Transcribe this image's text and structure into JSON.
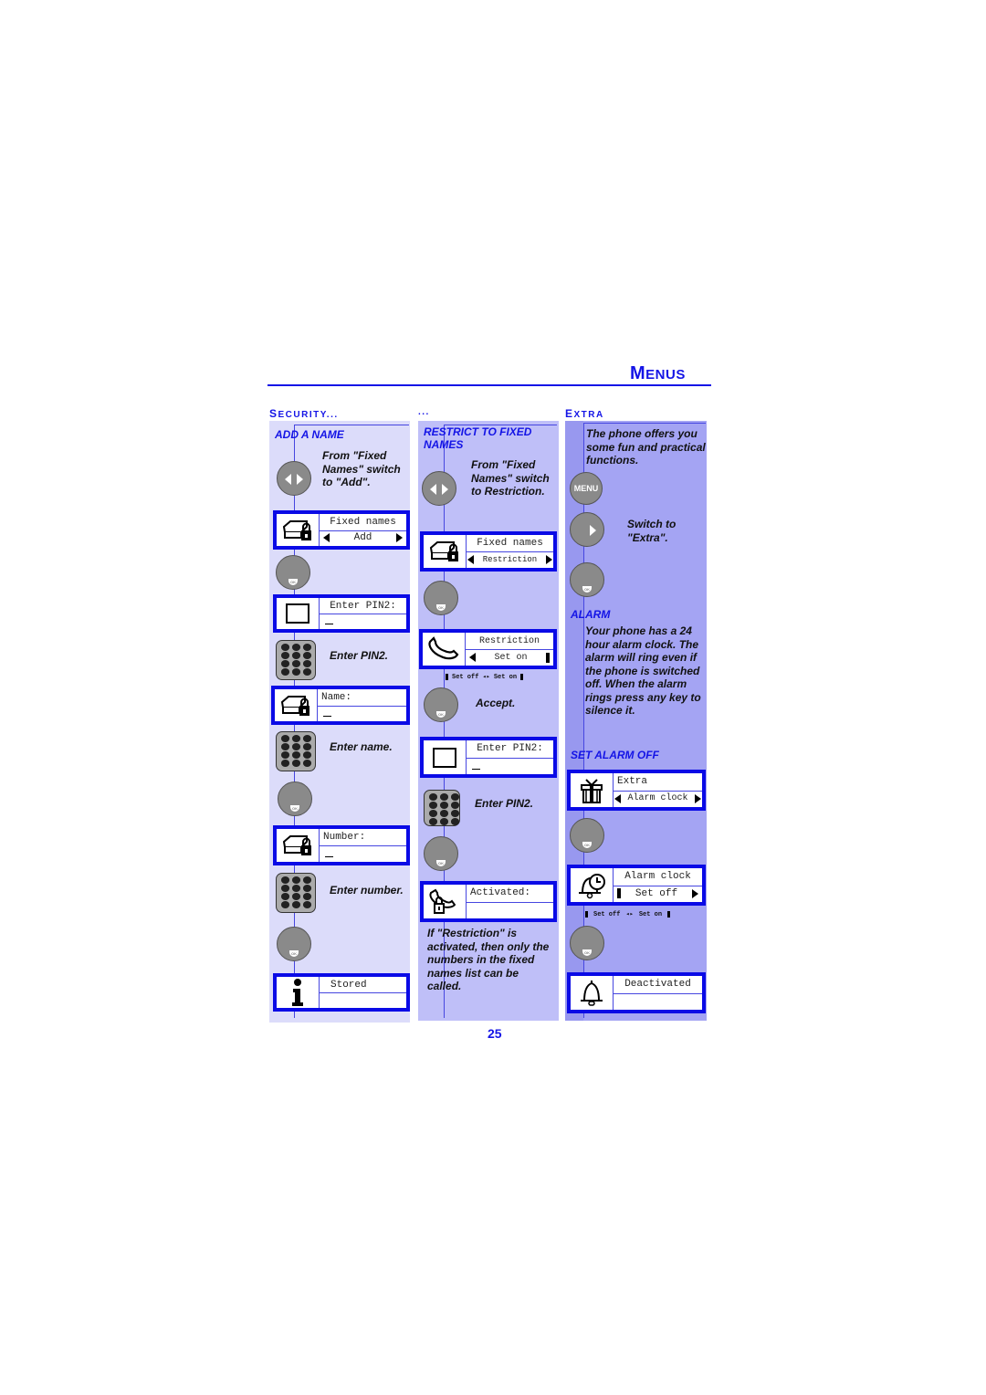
{
  "header": {
    "title_first": "M",
    "title_rest": "ENUS"
  },
  "sections": {
    "security": {
      "cap": "S",
      "rest": "ECURITY..."
    },
    "continued": {
      "label": "..."
    },
    "extra": {
      "cap": "E",
      "rest": "XTRA"
    }
  },
  "col1": {
    "title": "ADD A NAME",
    "step1_note": "From \"Fixed Names\" switch to \"Add\".",
    "screen1": {
      "line1": "Fixed names",
      "line2": "Add",
      "icon": "phonebook-lock-icon"
    },
    "screen2": {
      "line1": "Enter PIN2:",
      "icon": "empty-square-icon"
    },
    "step_pin_note": "Enter PIN2.",
    "screen3": {
      "line1": "Name:",
      "icon": "phonebook-lock-icon"
    },
    "step_name_note": "Enter name.",
    "screen4": {
      "line1": "Number:",
      "icon": "phonebook-lock-icon"
    },
    "step_number_note": "Enter number.",
    "screen5": {
      "line1": "Stored",
      "icon": "info-icon"
    }
  },
  "col2": {
    "title_line1": "RESTRICT TO FIXED",
    "title_line2": "NAMES",
    "step1_note": "From \"Fixed Names\" switch to Restriction.",
    "screen1": {
      "line1": "Fixed names",
      "line2": "Restriction",
      "icon": "phonebook-lock-icon"
    },
    "screen2": {
      "line1": "Restriction",
      "line2": "Set on",
      "icon": "handset-icon"
    },
    "legend": {
      "left": "Set off",
      "right": "Set on"
    },
    "accept_note": "Accept.",
    "screen3": {
      "line1": "Enter PIN2:",
      "icon": "empty-square-icon"
    },
    "step_pin_note": "Enter PIN2.",
    "screen4": {
      "line1": "Activated:",
      "icon": "handset-lock-icon"
    },
    "footer_note": "If \"Restriction\" is activated, then only the numbers in the fixed names list can be called."
  },
  "col3": {
    "intro_note": "The phone offers you some fun and practical functions.",
    "menu_label": "MENU",
    "switch_note": "Switch to \"Extra\".",
    "alarm_title": "ALARM",
    "alarm_note": "Your phone has a 24 hour alarm clock. The alarm will ring even if the phone is switched off. When the alarm rings press any key to silence it.",
    "set_alarm_off_title": "SET ALARM OFF",
    "screen1": {
      "line1": "Extra",
      "line2": "Alarm clock",
      "icon": "gift-icon"
    },
    "screen2": {
      "line1": "Alarm clock",
      "line2": "Set off",
      "icon": "alarm-bell-clock-icon"
    },
    "legend": {
      "left": "Set off",
      "right": "Set on"
    },
    "screen3": {
      "line1": "Deactivated",
      "icon": "bell-icon"
    }
  },
  "ok_label": "OK",
  "page_number": "25",
  "colors": {
    "accent": "#1414e6",
    "col1_bg": "#dcdcfa",
    "col2_bg": "#bfbff8",
    "col3_bg": "#a4a4f3",
    "screen_border": "#0a0ae6"
  }
}
